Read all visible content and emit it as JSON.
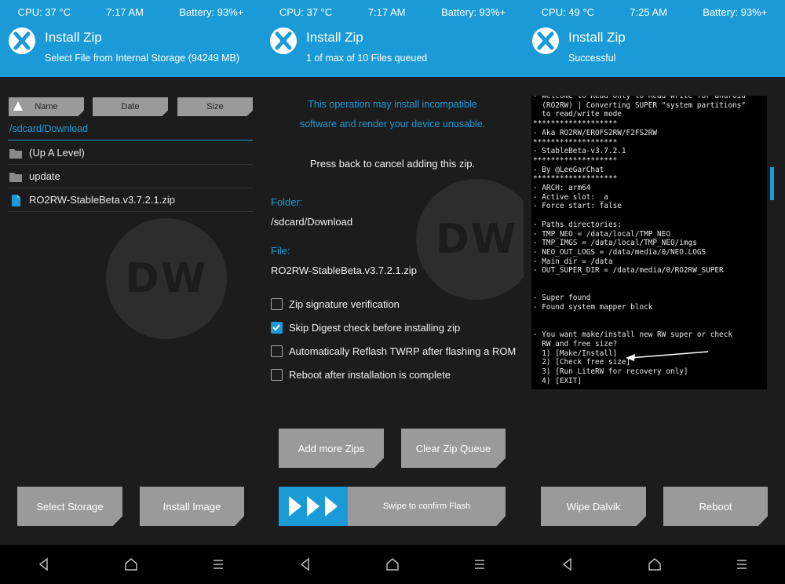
{
  "panels": [
    {
      "status": {
        "cpu": "CPU: 37 °C",
        "time": "7:17 AM",
        "battery": "Battery: 93%+"
      },
      "header": {
        "title": "Install Zip",
        "subtitle": "Select File from Internal Storage (94249 MB)"
      },
      "sort": {
        "name": "Name",
        "date": "Date",
        "size": "Size"
      },
      "path": "/sdcard/Download",
      "files": [
        {
          "label": "(Up A Level)",
          "icon": "folder-icon"
        },
        {
          "label": "update",
          "icon": "folder-icon"
        },
        {
          "label": "RO2RW-StableBeta.v3.7.2.1.zip",
          "icon": "file-icon"
        }
      ],
      "buttons": {
        "select_storage": "Select Storage",
        "install_image": "Install Image"
      }
    },
    {
      "status": {
        "cpu": "CPU: 37 °C",
        "time": "7:17 AM",
        "battery": "Battery: 93%+"
      },
      "header": {
        "title": "Install Zip",
        "subtitle": "1 of max of 10 Files queued"
      },
      "warning_line1": "This operation may install incompatible",
      "warning_line2": "software and render your device unusable.",
      "cancel_hint": "Press back to cancel adding this zip.",
      "folder_label": "Folder:",
      "folder_value": "/sdcard/Download",
      "file_label": "File:",
      "file_value": "RO2RW-StableBeta.v3.7.2.1.zip",
      "options": [
        {
          "label": "Zip signature verification",
          "checked": false
        },
        {
          "label": "Skip Digest check before installing zip",
          "checked": true
        },
        {
          "label": "Automatically Reflash TWRP after flashing a ROM",
          "checked": false
        },
        {
          "label": "Reboot after installation is complete",
          "checked": false
        }
      ],
      "buttons": {
        "add_more": "Add more Zips",
        "clear_queue": "Clear Zip Queue"
      },
      "swipe_label": "Swipe to confirm Flash"
    },
    {
      "status": {
        "cpu": "CPU: 49 °C",
        "time": "7:25 AM",
        "battery": "Battery: 93%+"
      },
      "header": {
        "title": "Install Zip",
        "subtitle": "Successful"
      },
      "console": "- Welcome to Read Only to Read Write for android\n  (RO2RW) | Converting SUPER \"system partitions\"\n  to read/write mode\n*******************\n- Aka RO2RW/EROFS2RW/F2FS2RW\n*******************\n- StableBeta-v3.7.2.1\n*******************\n- By @LeeGarChat\n*******************\n- ARCH: arm64\n- Active slot: _a\n- Force start: false\n\n- Paths directories:\n- TMP_NEO = /data/local/TMP_NEO\n- TMP_IMGS = /data/local/TMP_NEO/imgs\n- NEO_OUT_LOGS = /data/media/0/NEO.LOGS\n- Main_dir = /data\n- OUT_SUPER_DIR = /data/media/0/RO2RW_SUPER\n\n\n- Super found\n- Found system mapper block\n\n\n- You want make/install new RW super or check\n  RW and free size?\n  1) [Make/Install]\n  2) [Check free size]\n  3) [Run LiteRW for recovery only]\n  4) [EXIT]",
      "buttons": {
        "wipe_dalvik": "Wipe Dalvik",
        "reboot": "Reboot"
      }
    }
  ],
  "watermark": "DW",
  "colors": {
    "accent": "#1a9bd7",
    "background": "#1c1c1c",
    "button": "#9a9a9a"
  }
}
